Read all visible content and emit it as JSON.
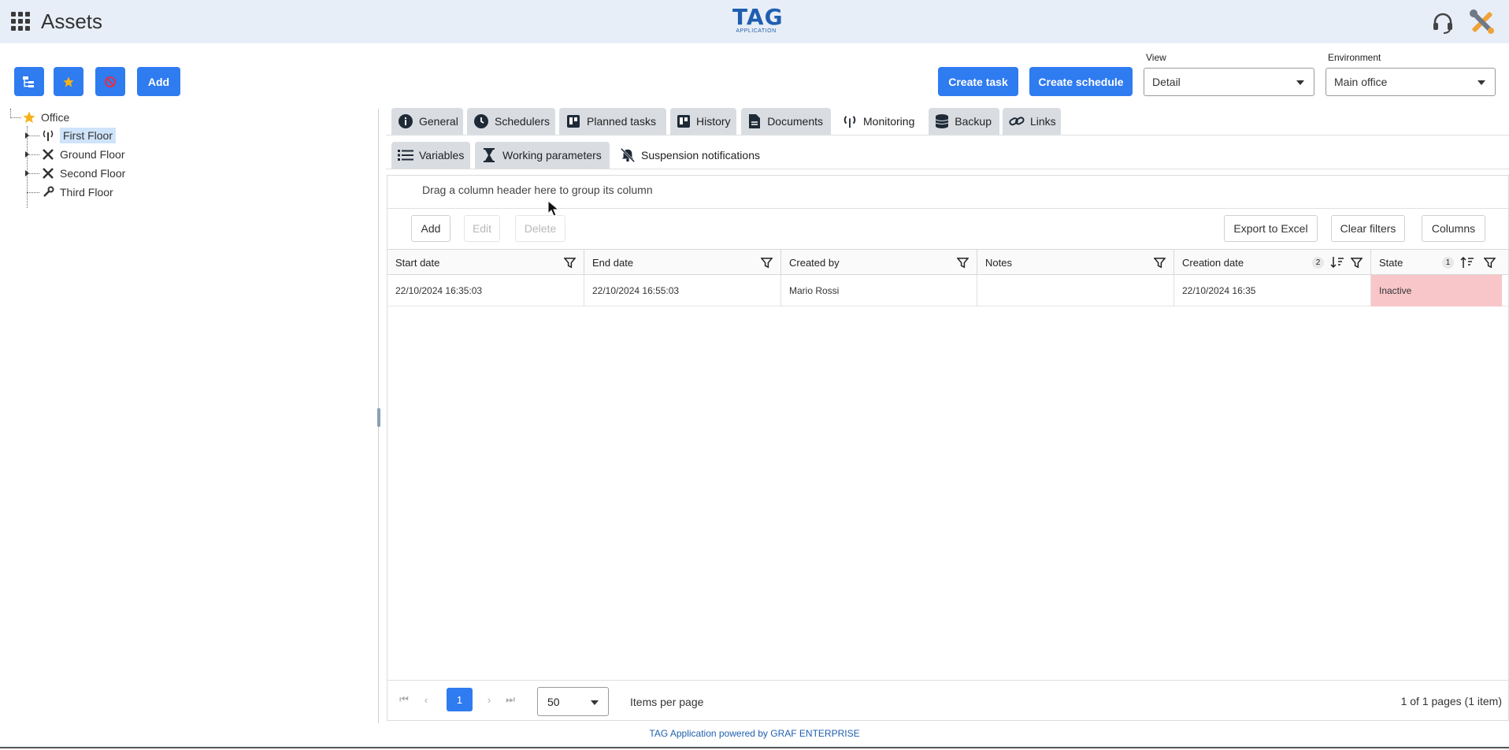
{
  "header": {
    "title": "Assets",
    "logo_main": "TAG",
    "logo_sub": "APPLICATION"
  },
  "toolbar": {
    "add_label": "Add",
    "create_task_label": "Create task",
    "create_schedule_label": "Create schedule",
    "view_label": "View",
    "view_value": "Detail",
    "environment_label": "Environment",
    "environment_value": "Main office"
  },
  "tree": {
    "root": "Office",
    "items": [
      "First Floor",
      "Ground Floor",
      "Second Floor",
      "Third Floor"
    ]
  },
  "tabs": [
    {
      "label": "General",
      "icon": "info-icon"
    },
    {
      "label": "Schedulers",
      "icon": "clock-icon"
    },
    {
      "label": "Planned tasks",
      "icon": "board-icon"
    },
    {
      "label": "History",
      "icon": "board-icon"
    },
    {
      "label": "Documents",
      "icon": "document-icon"
    },
    {
      "label": "Monitoring",
      "icon": "antenna-icon"
    },
    {
      "label": "Backup",
      "icon": "database-icon"
    },
    {
      "label": "Links",
      "icon": "link-icon"
    }
  ],
  "subtabs": [
    {
      "label": "Variables",
      "icon": "list-icon"
    },
    {
      "label": "Working parameters",
      "icon": "hourglass-icon"
    },
    {
      "label": "Suspension notifications",
      "icon": "bell-slash-icon"
    }
  ],
  "grid": {
    "group_hint": "Drag a column header here to group its column",
    "add_label": "Add",
    "edit_label": "Edit",
    "delete_label": "Delete",
    "export_label": "Export to Excel",
    "clear_filters_label": "Clear filters",
    "columns_label": "Columns",
    "headers": [
      "Start date",
      "End date",
      "Created by",
      "Notes",
      "Creation date",
      "State"
    ],
    "creation_sort_badge": "2",
    "state_sort_badge": "1",
    "rows": [
      {
        "start": "22/10/2024 16:35:03",
        "end": "22/10/2024 16:55:03",
        "created_by": "Mario Rossi",
        "notes": "",
        "creation": "22/10/2024 16:35",
        "state": "Inactive"
      }
    ],
    "pager": {
      "current_page": "1",
      "per_page": "50",
      "items_per_page_label": "Items per page",
      "info": "1 of 1 pages (1 item)"
    }
  },
  "footer": {
    "text": "TAG Application powered by GRAF ENTERPRISE"
  },
  "colors": {
    "primary": "#2f7bf0",
    "header_bg": "#e8eef7",
    "inactive_bg": "#f8c6c9",
    "brand": "#1f5fb0"
  }
}
